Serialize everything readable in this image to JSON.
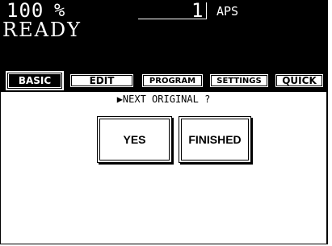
{
  "header": {
    "zoom_value": "100",
    "zoom_unit": "%",
    "copy_count": "1",
    "paper_mode": "APS",
    "status": "READY"
  },
  "tabs": [
    {
      "label": "BASIC",
      "active": true
    },
    {
      "label": "EDIT",
      "active": false
    },
    {
      "label": "PROGRAM",
      "active": false
    },
    {
      "label": "SETTINGS",
      "active": false
    },
    {
      "label": "QUICK",
      "active": false
    }
  ],
  "main": {
    "prompt": "▶NEXT ORIGINAL ?",
    "yes_label": "YES",
    "finished_label": "FINISHED"
  }
}
